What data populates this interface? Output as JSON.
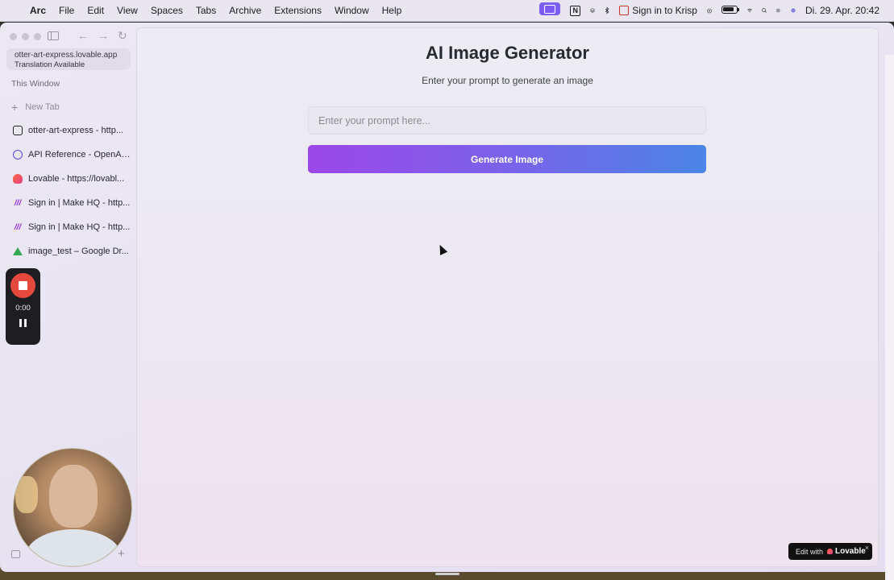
{
  "menubar": {
    "apple": "",
    "app_name": "Arc",
    "menus": [
      "File",
      "Edit",
      "View",
      "Spaces",
      "Tabs",
      "Archive",
      "Extensions",
      "Window",
      "Help"
    ],
    "krisp_label": "Sign in to Krisp",
    "notion_letter": "N",
    "datetime": "Di. 29. Apr.  20:42"
  },
  "sidebar": {
    "url": "otter-art-express.lovable.app",
    "url_sub": "Translation Available",
    "section_label": "This Window",
    "new_tab_label": "New Tab",
    "tabs": [
      {
        "label": "otter-art-express - http...",
        "icon": "github-icon"
      },
      {
        "label": "API Reference - OpenAI...",
        "icon": "openai-icon"
      },
      {
        "label": "Lovable - https://lovabl...",
        "icon": "lovable-icon"
      },
      {
        "label": "Sign in | Make HQ - http...",
        "icon": "make-icon"
      },
      {
        "label": "Sign in | Make HQ - http...",
        "icon": "make-icon"
      },
      {
        "label": "image_test – Google Dr...",
        "icon": "google-drive-icon"
      }
    ]
  },
  "recorder": {
    "time": "0:00"
  },
  "page": {
    "title": "AI Image Generator",
    "subtitle": "Enter your prompt to generate an image",
    "prompt_placeholder": "Enter your prompt here...",
    "prompt_value": "",
    "generate_label": "Generate Image"
  },
  "lovable_badge": {
    "edit_label": "Edit with",
    "brand": "Lovable",
    "close": "×"
  },
  "colors": {
    "button_gradient_start": "#9b47e6",
    "button_gradient_end": "#4b86e6",
    "recording_red": "#e5483d"
  }
}
